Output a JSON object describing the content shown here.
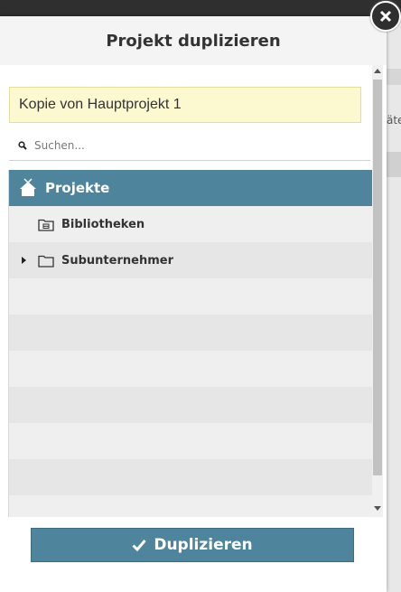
{
  "dialog": {
    "title": "Projekt duplizieren",
    "name_value": "Kopie von Hauptprojekt 1",
    "search_placeholder": "Suchen...",
    "primary_button": "Duplizieren",
    "primary_button_icon": "check-icon",
    "close_icon": "close-icon"
  },
  "tree": {
    "root": {
      "label": "Projekte",
      "icon": "home-icon"
    },
    "items": [
      {
        "label": "Bibliotheken",
        "icon": "library-folder-icon",
        "expandable": false
      },
      {
        "label": "Subunternehmer",
        "icon": "folder-icon",
        "expandable": true
      }
    ]
  },
  "background": {
    "fragment": "äte"
  },
  "colors": {
    "accent": "#4f849d",
    "input_highlight": "#fcf8cf",
    "header_bg": "#f4f4f4"
  }
}
